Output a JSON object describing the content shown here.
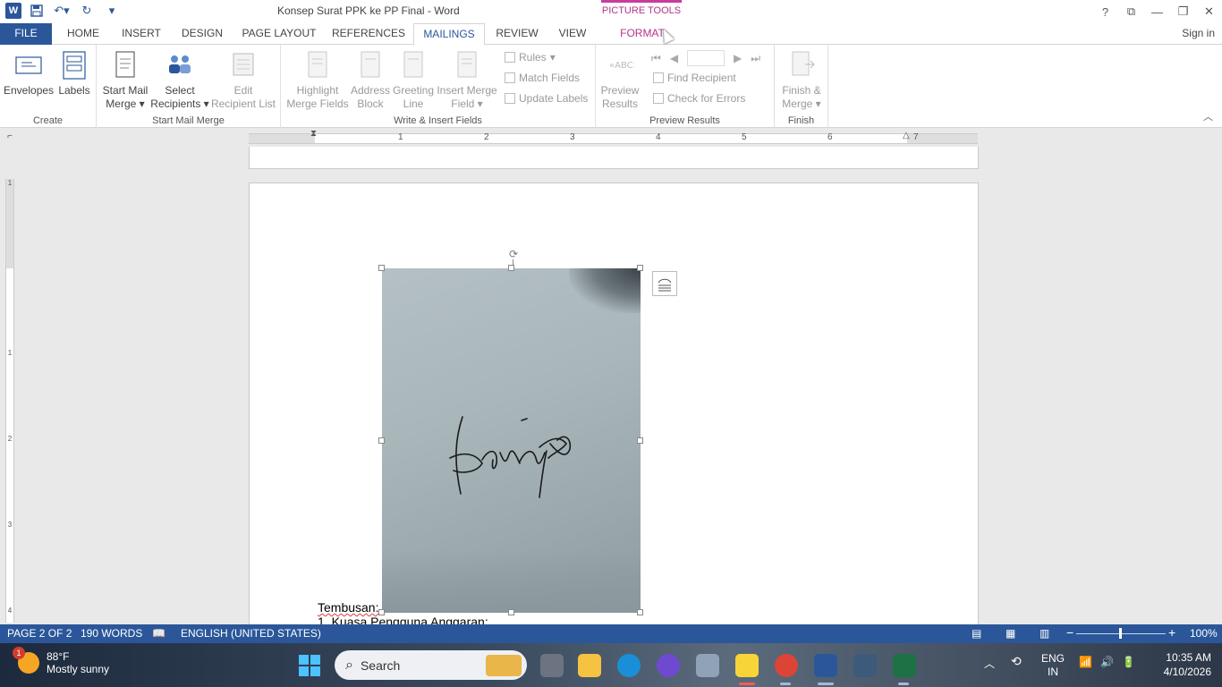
{
  "window": {
    "title": "Konsep Surat PPK ke PP Final - Word",
    "app_icon": "W",
    "context_tab_group": "PICTURE TOOLS",
    "controls": [
      "?",
      "⧉",
      "—",
      "❐",
      "✕"
    ]
  },
  "tabs": [
    {
      "label": "FILE"
    },
    {
      "label": "HOME"
    },
    {
      "label": "INSERT"
    },
    {
      "label": "DESIGN"
    },
    {
      "label": "PAGE LAYOUT"
    },
    {
      "label": "REFERENCES"
    },
    {
      "label": "MAILINGS",
      "active": true
    },
    {
      "label": "REVIEW"
    },
    {
      "label": "VIEW"
    },
    {
      "label": "FORMAT"
    }
  ],
  "signin": "Sign in",
  "ribbon": {
    "create": {
      "label": "Create",
      "envelopes": "Envelopes",
      "labels": "Labels"
    },
    "start_mail_merge": {
      "label": "Start Mail Merge",
      "start_l1": "Start Mail",
      "start_l2": "Merge",
      "select_l1": "Select",
      "select_l2": "Recipients",
      "edit_l1": "Edit",
      "edit_l2": "Recipient List"
    },
    "write_insert": {
      "label": "Write & Insert Fields",
      "highlight_l1": "Highlight",
      "highlight_l2": "Merge Fields",
      "address_l1": "Address",
      "address_l2": "Block",
      "greeting_l1": "Greeting",
      "greeting_l2": "Line",
      "insert_l1": "Insert Merge",
      "insert_l2": "Field",
      "rules": "Rules",
      "match_fields": "Match Fields",
      "update_labels": "Update Labels"
    },
    "preview": {
      "label": "Preview Results",
      "preview_l1": "Preview",
      "preview_l2": "Results",
      "find_recipient": "Find Recipient",
      "check_errors": "Check for Errors"
    },
    "finish": {
      "label": "Finish",
      "finish_l1": "Finish &",
      "finish_l2": "Merge"
    }
  },
  "ruler": {
    "numbers": [
      "1",
      "2",
      "3",
      "4",
      "5",
      "6",
      "7"
    ],
    "vnumbers": [
      "1",
      "1",
      "2",
      "3",
      "4"
    ]
  },
  "document": {
    "line1": "Tembusan:",
    "line2": "1. Kuasa Pengguna Anggaran;"
  },
  "statusbar": {
    "page": "PAGE 2 OF 2",
    "words": "190 WORDS",
    "language": "ENGLISH (UNITED STATES)",
    "zoom": "100%",
    "zoom_minus": "−",
    "zoom_plus": "+"
  },
  "taskbar": {
    "temp": "88°F",
    "weather": "Mostly sunny",
    "badge": "1",
    "search": "Search",
    "lang1": "ENG",
    "lang2": "IN",
    "time": "10:35 AM",
    "date": "4/10/2026"
  }
}
